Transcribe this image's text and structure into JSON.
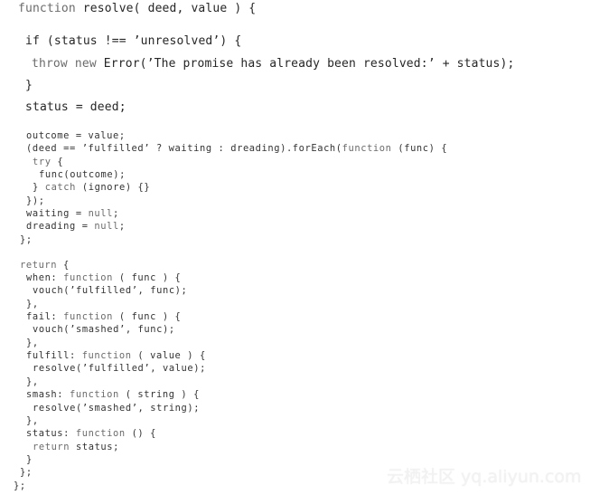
{
  "code": {
    "language": "javascript",
    "top_lines": [
      {
        "indent": 0,
        "segments": [
          {
            "t": "function",
            "kw": true
          },
          {
            "t": " resolve( deed, value ) {"
          }
        ]
      },
      {
        "indent": 1,
        "segments": [
          {
            "t": "if (status !== ’unresolved’) {"
          }
        ]
      },
      {
        "indent": 2,
        "segments": [
          {
            "t": "throw",
            "kw": true
          },
          {
            "t": " "
          },
          {
            "t": "new",
            "kw": true
          },
          {
            "t": " Error(’The promise has already been resolved:’ + status);"
          }
        ]
      },
      {
        "indent": 1,
        "segments": [
          {
            "t": "}"
          }
        ]
      },
      {
        "indent": 1,
        "segments": [
          {
            "t": "status = deed;"
          }
        ]
      }
    ],
    "lines": [
      {
        "indent": 1,
        "segments": [
          {
            "t": "outcome = value;"
          }
        ]
      },
      {
        "indent": 1,
        "segments": [
          {
            "t": "(deed == ’fulfilled’ ? waiting : dreading).forEach("
          },
          {
            "t": "function",
            "kw": true
          },
          {
            "t": " (func) {"
          }
        ]
      },
      {
        "indent": 2,
        "segments": [
          {
            "t": "try",
            "kw": true
          },
          {
            "t": " {"
          }
        ]
      },
      {
        "indent": 3,
        "segments": [
          {
            "t": "func(outcome);"
          }
        ]
      },
      {
        "indent": 2,
        "segments": [
          {
            "t": "} "
          },
          {
            "t": "catch",
            "kw": true
          },
          {
            "t": " (ignore) {}"
          }
        ]
      },
      {
        "indent": 1,
        "segments": [
          {
            "t": "});"
          }
        ]
      },
      {
        "indent": 1,
        "segments": [
          {
            "t": "waiting = "
          },
          {
            "t": "null",
            "kw": true
          },
          {
            "t": ";"
          }
        ]
      },
      {
        "indent": 1,
        "segments": [
          {
            "t": "dreading = "
          },
          {
            "t": "null",
            "kw": true
          },
          {
            "t": ";"
          }
        ]
      },
      {
        "indent": 0,
        "segments": [
          {
            "t": "};"
          }
        ]
      },
      {
        "indent": 0,
        "gap": true,
        "segments": [
          {
            "t": "return",
            "kw": true
          },
          {
            "t": " {"
          }
        ]
      },
      {
        "indent": 1,
        "segments": [
          {
            "t": "when: "
          },
          {
            "t": "function",
            "kw": true
          },
          {
            "t": " ( func ) {"
          }
        ]
      },
      {
        "indent": 2,
        "segments": [
          {
            "t": "vouch(’fulfilled’, func);"
          }
        ]
      },
      {
        "indent": 1,
        "segments": [
          {
            "t": "},"
          }
        ]
      },
      {
        "indent": 1,
        "segments": [
          {
            "t": "fail: "
          },
          {
            "t": "function",
            "kw": true
          },
          {
            "t": " ( func ) {"
          }
        ]
      },
      {
        "indent": 2,
        "segments": [
          {
            "t": "vouch(’smashed’, func);"
          }
        ]
      },
      {
        "indent": 1,
        "segments": [
          {
            "t": "},"
          }
        ]
      },
      {
        "indent": 1,
        "segments": [
          {
            "t": "fulfill: "
          },
          {
            "t": "function",
            "kw": true
          },
          {
            "t": " ( value ) {"
          }
        ]
      },
      {
        "indent": 2,
        "segments": [
          {
            "t": "resolve(’fulfilled’, value);"
          }
        ]
      },
      {
        "indent": 1,
        "segments": [
          {
            "t": "},"
          }
        ]
      },
      {
        "indent": 1,
        "segments": [
          {
            "t": "smash: "
          },
          {
            "t": "function",
            "kw": true
          },
          {
            "t": " ( string ) {"
          }
        ]
      },
      {
        "indent": 2,
        "segments": [
          {
            "t": "resolve(’smashed’, string);"
          }
        ]
      },
      {
        "indent": 1,
        "segments": [
          {
            "t": "},"
          }
        ]
      },
      {
        "indent": 1,
        "segments": [
          {
            "t": "status: "
          },
          {
            "t": "function",
            "kw": true
          },
          {
            "t": " () {"
          }
        ]
      },
      {
        "indent": 2,
        "segments": [
          {
            "t": "return",
            "kw": true
          },
          {
            "t": " status;"
          }
        ]
      },
      {
        "indent": 1,
        "segments": [
          {
            "t": "}"
          }
        ]
      },
      {
        "indent": 0,
        "segments": [
          {
            "t": "};"
          }
        ]
      },
      {
        "indent": -1,
        "segments": [
          {
            "t": "};"
          }
        ]
      }
    ]
  },
  "watermark": {
    "text": "云栖社区 yq.aliyun.com"
  }
}
